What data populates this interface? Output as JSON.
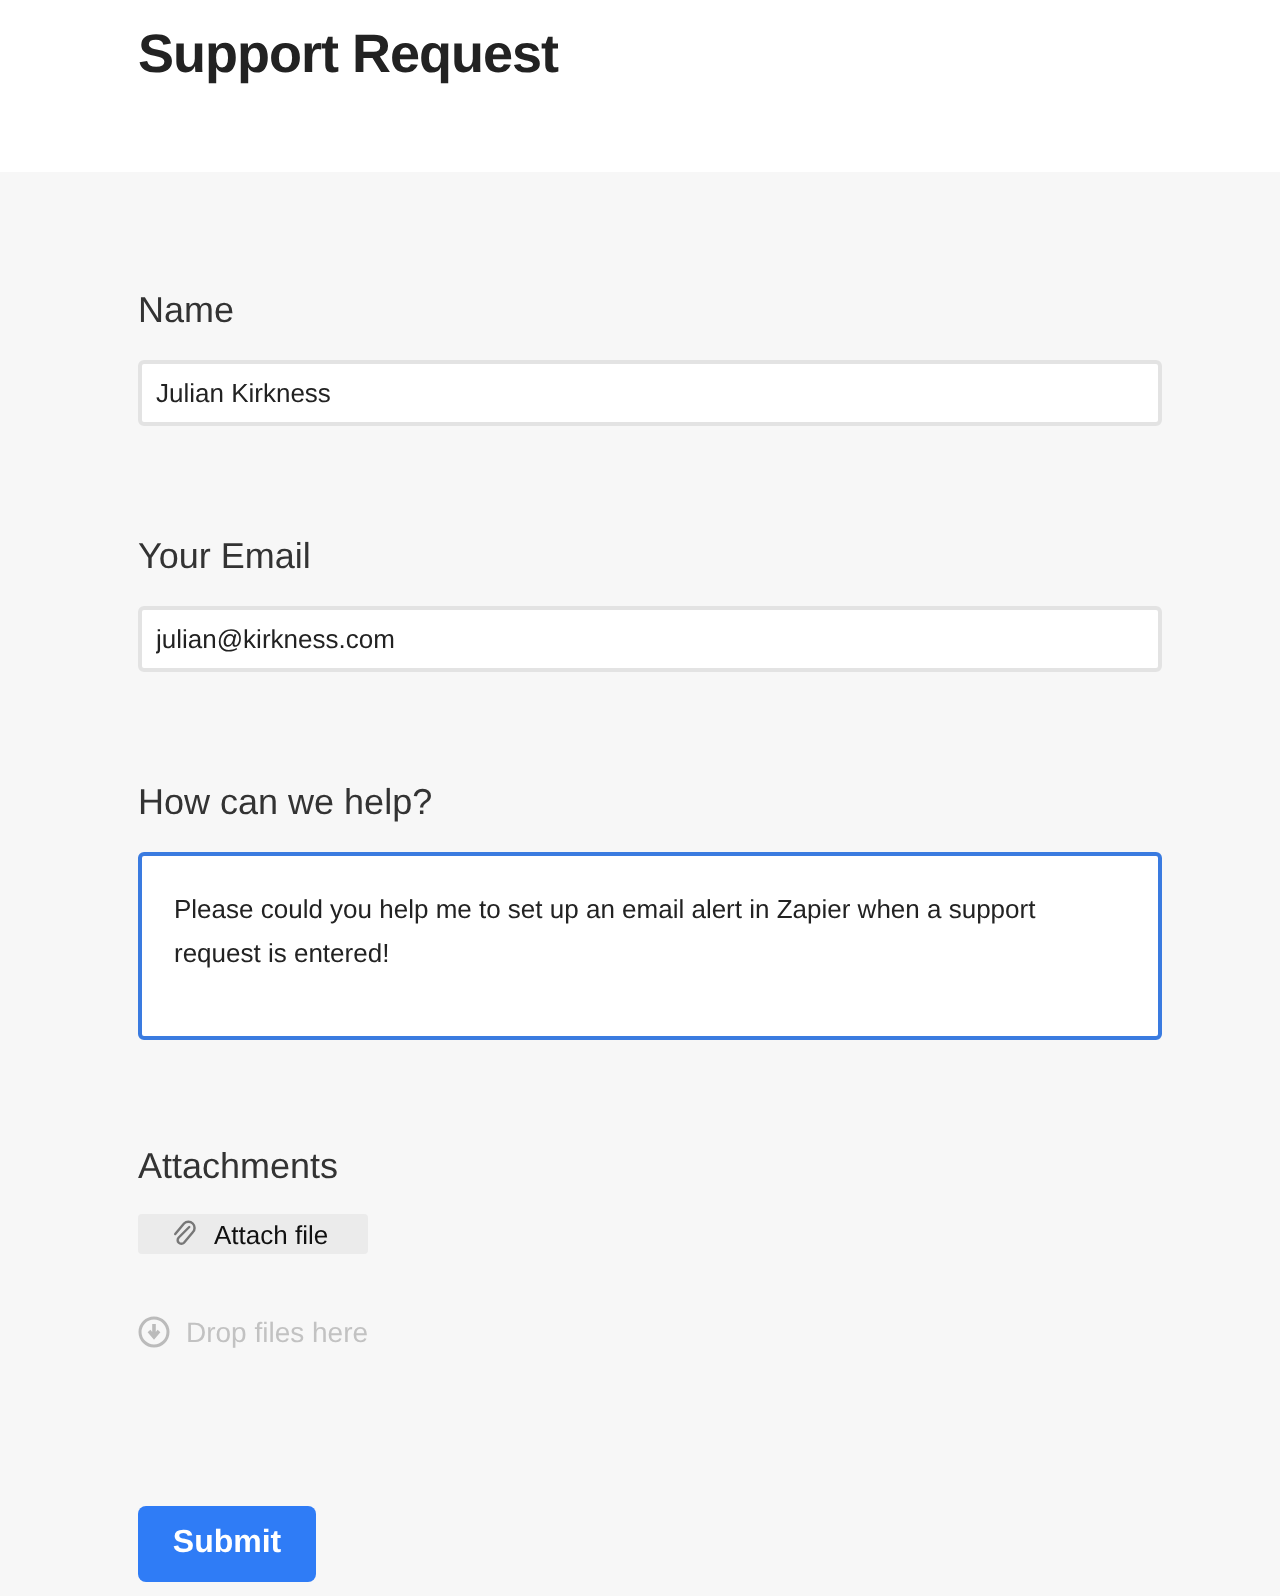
{
  "title": "Support Request",
  "fields": [
    {
      "kind": "input",
      "label": "Name",
      "value": "Julian Kirkness",
      "focused": false
    },
    {
      "kind": "input",
      "label": "Your Email",
      "value": "julian@kirkness.com",
      "focused": false
    },
    {
      "kind": "textarea",
      "label": "How can we help?",
      "value": "Please could you help me to set up an email alert in Zapier when a support request is entered!",
      "focused": true
    }
  ],
  "attachments": {
    "label": "Attachments",
    "button": "Attach file",
    "drop_hint": "Drop files here"
  },
  "submit": "Submit"
}
